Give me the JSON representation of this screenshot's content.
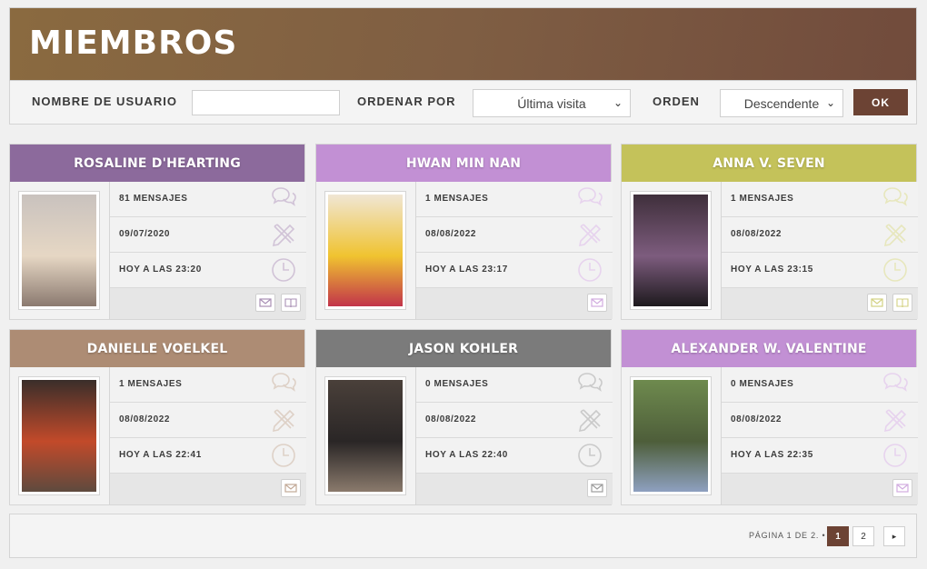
{
  "page": {
    "title": "MIEMBROS",
    "accent": "#6c4334"
  },
  "filters": {
    "username_label": "NOMBRE DE USUARIO",
    "username_value": "",
    "sort_label": "ORDENAR POR",
    "sort_value": "Última visita",
    "order_label": "ORDEN",
    "order_value": "Descendente",
    "ok_label": "OK"
  },
  "members": [
    {
      "name": "ROSALINE D'HEARTING",
      "color": "#8c6a9c",
      "posts": "81 MENSAJES",
      "joined": "09/07/2020",
      "last_visit": "HOY A LAS 23:20",
      "actions": [
        "mail-icon",
        "profile-book-icon"
      ]
    },
    {
      "name": "HWAN MIN NAN",
      "color": "#c290d4",
      "posts": "1 MENSAJES",
      "joined": "08/08/2022",
      "last_visit": "HOY A LAS 23:17",
      "actions": [
        "mail-icon"
      ]
    },
    {
      "name": "ANNA V. SEVEN",
      "color": "#c4c25a",
      "posts": "1 MENSAJES",
      "joined": "08/08/2022",
      "last_visit": "HOY A LAS 23:15",
      "actions": [
        "mail-icon",
        "profile-book-icon"
      ]
    },
    {
      "name": "DANIELLE VOELKEL",
      "color": "#ad8c74",
      "posts": "1 MENSAJES",
      "joined": "08/08/2022",
      "last_visit": "HOY A LAS 22:41",
      "actions": [
        "mail-icon"
      ]
    },
    {
      "name": "JASON KOHLER",
      "color": "#7b7b7b",
      "posts": "0 MENSAJES",
      "joined": "08/08/2022",
      "last_visit": "HOY A LAS 22:40",
      "actions": [
        "mail-icon"
      ]
    },
    {
      "name": "ALEXANDER W. VALENTINE",
      "color": "#c290d4",
      "posts": "0 MENSAJES",
      "joined": "08/08/2022",
      "last_visit": "HOY A LAS 22:35",
      "actions": [
        "mail-icon"
      ]
    }
  ],
  "pagination": {
    "label": "PÁGINA 1 DE 2. •",
    "pages": [
      "1",
      "2"
    ],
    "current": "1",
    "next_icon": "chevron-right-icon"
  }
}
